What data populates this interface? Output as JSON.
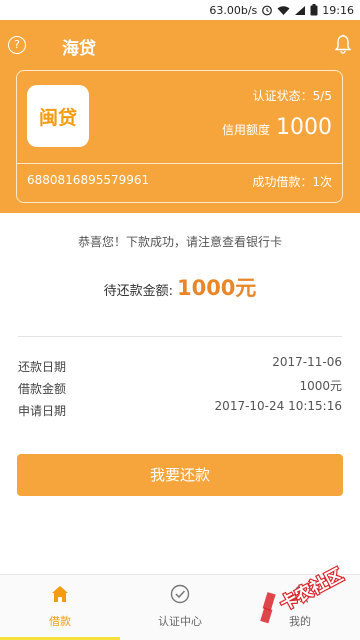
{
  "status_bar": {
    "network_speed": "63.00b/s",
    "time": "19:16"
  },
  "header": {
    "title": "海贷"
  },
  "card": {
    "logo_text": "闽贷",
    "auth_status": "认证状态：5/5",
    "credit_label": "信用额度",
    "credit_value": "1000",
    "card_number": "6880816895579961",
    "success_count": "成功借款：1次"
  },
  "notice": "恭喜您！下款成功，请注意查看银行卡",
  "pending": {
    "label": "待还款金额:",
    "amount": "1000元"
  },
  "details": [
    {
      "label": "还款日期",
      "value": "2017-11-06"
    },
    {
      "label": "借款金额",
      "value": "1000元"
    },
    {
      "label": "申请日期",
      "value": "2017-10-24 10:15:16"
    }
  ],
  "repay_button": "我要还款",
  "tabs": [
    {
      "label": "借款",
      "icon": "home-icon",
      "active": true
    },
    {
      "label": "认证中心",
      "icon": "check-circle-icon",
      "active": false
    },
    {
      "label": "我的",
      "icon": "person-icon",
      "active": false
    }
  ],
  "watermark": {
    "text": "卡农社区"
  },
  "colors": {
    "accent": "#f6a53c",
    "amount": "#e8872a",
    "tab_active": "#f39c12"
  }
}
